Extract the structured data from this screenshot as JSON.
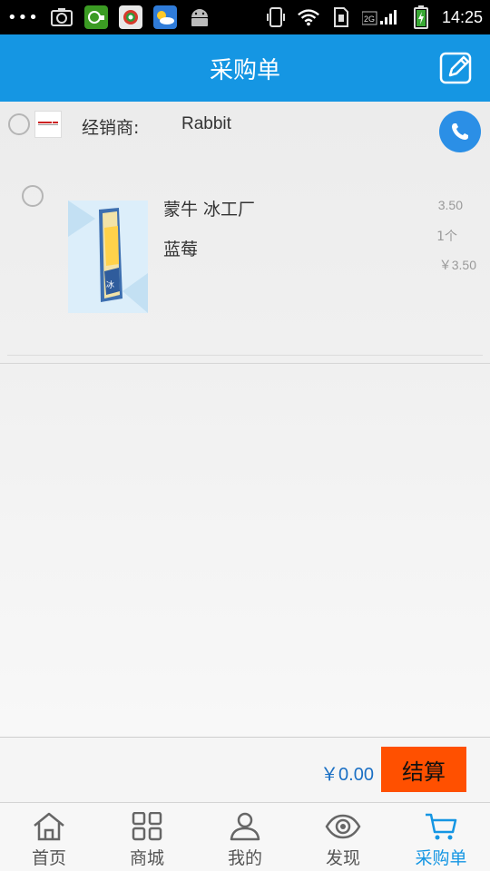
{
  "status_bar": {
    "time": "14:25",
    "network": "2G",
    "overflow_icon": "more-dots-icon",
    "left_icons": [
      "screenshot-icon",
      "app-icon-green",
      "app-icon-browser",
      "weather-icon",
      "android-icon"
    ],
    "right_icons": [
      "vibrate-icon",
      "wifi-icon",
      "sim-icon",
      "signal-icon",
      "battery-icon"
    ]
  },
  "header": {
    "title": "采购单",
    "edit_icon": "edit-icon"
  },
  "dealer": {
    "label": "经销商:",
    "name": "Rabbit",
    "phone_icon": "phone-icon"
  },
  "product": {
    "name": "蒙牛 冰工厂",
    "variant": "蓝莓",
    "price": "3.50",
    "quantity": "1个",
    "subtotal": "￥3.50"
  },
  "checkout": {
    "total": "￥0.00",
    "button_label": "结算"
  },
  "tabs": [
    {
      "label": "首页",
      "icon": "home-icon",
      "active": false
    },
    {
      "label": "商城",
      "icon": "grid-icon",
      "active": false
    },
    {
      "label": "我的",
      "icon": "person-icon",
      "active": false
    },
    {
      "label": "发现",
      "icon": "eye-icon",
      "active": false
    },
    {
      "label": "采购单",
      "icon": "cart-icon",
      "active": true
    }
  ],
  "colors": {
    "primary": "#1596e3",
    "checkout_button": "#ff5000",
    "total_text": "#1a6fc4"
  }
}
